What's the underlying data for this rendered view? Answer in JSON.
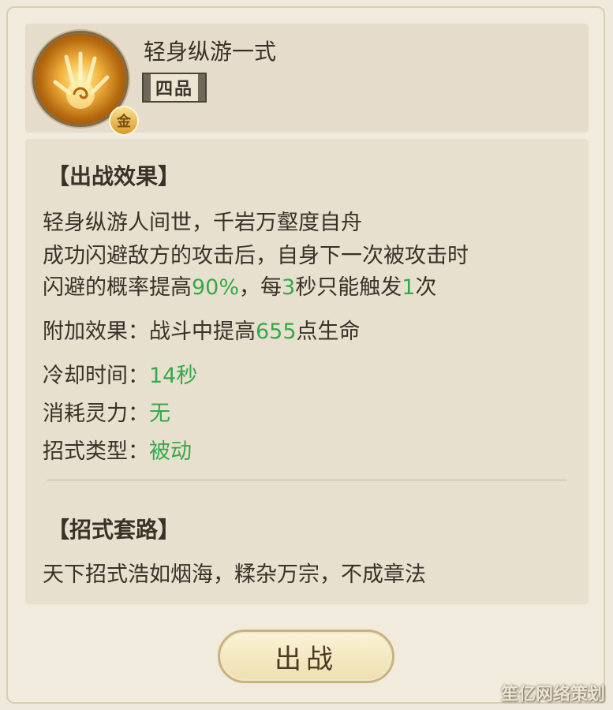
{
  "skill": {
    "name": "轻身纵游一式",
    "rank": "四品",
    "badge": "金"
  },
  "battle_effect": {
    "title": "【出战效果】",
    "poem": "轻身纵游人间世，千岩万壑度自舟",
    "desc_line1": "成功闪避敌方的攻击后，自身下一次被攻击时",
    "desc_line2_prefix": "闪避的概率提高",
    "desc_value1": "90%",
    "desc_mid1": "，每",
    "desc_value2": "3",
    "desc_mid2": "秒只能触发",
    "desc_value3": "1",
    "desc_suffix": "次",
    "extra_prefix": "附加效果：战斗中提高",
    "extra_value": "655",
    "extra_suffix": "点生命",
    "cooldown_label": "冷却时间：",
    "cooldown_value": "14秒",
    "cost_label": "消耗灵力：",
    "cost_value": "无",
    "type_label": "招式类型：",
    "type_value": "被动"
  },
  "moveset": {
    "title": "【招式套路】",
    "text": "天下招式浩如烟海，糅杂万宗，不成章法"
  },
  "button": {
    "label": "出战"
  },
  "watermark": "笙亿网络策划",
  "colors": {
    "highlight": "#35a84a",
    "text": "#3a3128",
    "panel": "#e8e0cf"
  }
}
